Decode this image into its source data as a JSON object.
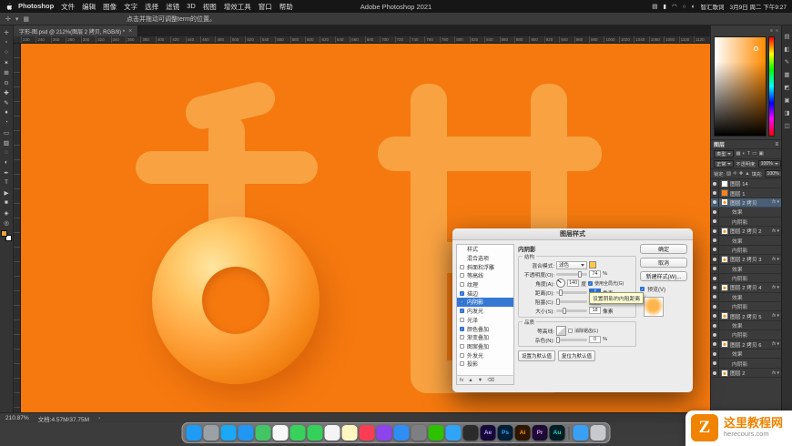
{
  "colors": {
    "canvas_bg": "#f5790f",
    "glyph": "#f9a242",
    "fg_swatch": "#f2a33c",
    "bg_swatch": "#ffffff",
    "swatch_yellow": "#ffc844",
    "accent": "#2f6fd0"
  },
  "icons": {
    "close": "×",
    "chevron": "›",
    "panel_menu": "≡",
    "collapse": "«"
  },
  "menubar": {
    "items": [
      "Photoshop",
      "文件",
      "编辑",
      "图像",
      "文字",
      "选择",
      "滤镜",
      "3D",
      "视图",
      "增效工具",
      "窗口",
      "帮助"
    ],
    "app_title": "Adobe Photoshop 2021",
    "status_icons": [
      {
        "name": "display-icon",
        "glyph": "▤"
      },
      {
        "name": "battery-icon",
        "glyph": "▮"
      },
      {
        "name": "wifi-icon",
        "glyph": "◠"
      },
      {
        "name": "search-icon",
        "glyph": "○"
      },
      {
        "name": "control-center-icon",
        "glyph": "◐"
      }
    ],
    "input_method": "智汇歌词",
    "datetime": "3月9日 周二 下午9:27"
  },
  "optionsbar": {
    "left_icons": [
      {
        "name": "tool-preset-icon",
        "glyph": "✛"
      },
      {
        "name": "auto-select-icon",
        "glyph": "▾"
      },
      {
        "name": "align-icon",
        "glyph": "▦"
      }
    ],
    "hint": "点击并拖动可调整term的位置。"
  },
  "tools": [
    {
      "name": "move-tool",
      "glyph": "✛"
    },
    {
      "name": "marquee-tool",
      "glyph": "▫"
    },
    {
      "name": "lasso-tool",
      "glyph": "○"
    },
    {
      "name": "quick-selection-tool",
      "glyph": "✶"
    },
    {
      "name": "crop-tool",
      "glyph": "⊞"
    },
    {
      "name": "eyedropper-tool",
      "glyph": "⊙"
    },
    {
      "name": "healing-brush-tool",
      "glyph": "✚"
    },
    {
      "name": "brush-tool",
      "glyph": "✎"
    },
    {
      "name": "clone-stamp-tool",
      "glyph": "♦"
    },
    {
      "name": "history-brush-tool",
      "glyph": "◔"
    },
    {
      "name": "eraser-tool",
      "glyph": "▭"
    },
    {
      "name": "gradient-tool",
      "glyph": "▨"
    },
    {
      "name": "blur-tool",
      "glyph": "◌"
    },
    {
      "name": "dodge-tool",
      "glyph": "◐"
    },
    {
      "name": "pen-tool",
      "glyph": "✒"
    },
    {
      "name": "type-tool",
      "glyph": "T"
    },
    {
      "name": "path-selection-tool",
      "glyph": "▶"
    },
    {
      "name": "shape-tool",
      "glyph": "■"
    },
    {
      "name": "hand-tool",
      "glyph": "◈"
    },
    {
      "name": "zoom-tool",
      "glyph": "◎"
    }
  ],
  "document": {
    "tab_title": "字形-图.psd @ 212%(图层 2 拷贝, RGB/8) *",
    "canvas_character": "甜",
    "ruler_ticks": [
      "220",
      "240",
      "260",
      "280",
      "300",
      "320",
      "340",
      "360",
      "380",
      "400",
      "420",
      "440",
      "460",
      "480",
      "500",
      "520",
      "540",
      "560",
      "580",
      "600",
      "620",
      "640",
      "660",
      "680",
      "700",
      "720",
      "740",
      "760",
      "780",
      "800",
      "820",
      "840",
      "860",
      "880",
      "900",
      "920",
      "940",
      "960",
      "980",
      "1000",
      "1020",
      "1040",
      "1060",
      "1080",
      "1100",
      "1120"
    ],
    "zoom_level": "210.87%",
    "doc_size": "文档:4.57M/37.75M"
  },
  "dialog": {
    "title": "图层样式",
    "left_items": [
      {
        "label": "样式",
        "checkbox": false
      },
      {
        "label": "混合选项",
        "checkbox": false
      },
      {
        "label": "斜面和浮雕",
        "checkbox": true,
        "checked": false
      },
      {
        "label": "等高线",
        "checkbox": true,
        "checked": false
      },
      {
        "label": "纹理",
        "checkbox": true,
        "checked": false
      },
      {
        "label": "描边",
        "checkbox": true,
        "checked": true
      },
      {
        "label": "内阴影",
        "checkbox": true,
        "checked": true,
        "selected": true
      },
      {
        "label": "内发光",
        "checkbox": true,
        "checked": true
      },
      {
        "label": "光泽",
        "checkbox": true,
        "checked": false
      },
      {
        "label": "颜色叠加",
        "checkbox": true,
        "checked": true
      },
      {
        "label": "渐变叠加",
        "checkbox": true,
        "checked": false
      },
      {
        "label": "图案叠加",
        "checkbox": true,
        "checked": false
      },
      {
        "label": "外发光",
        "checkbox": true,
        "checked": false
      },
      {
        "label": "投影",
        "checkbox": true,
        "checked": false
      }
    ],
    "list_foot_icons": [
      {
        "name": "add-effect-icon",
        "glyph": "fx"
      },
      {
        "name": "move-up-icon",
        "glyph": "▲"
      },
      {
        "name": "move-down-icon",
        "glyph": "▼"
      },
      {
        "name": "delete-effect-icon",
        "glyph": "⌫"
      }
    ],
    "panel": {
      "header": "内阴影",
      "structure_label": "结构",
      "blend_mode_label": "混合模式:",
      "blend_mode_value": "滤色",
      "opacity_label": "不透明度(O):",
      "opacity_value": "74",
      "opacity_unit": "%",
      "angle_label": "角度(A):",
      "angle_value": "140",
      "angle_unit": "度",
      "global_light_label": "使用全局光(G)",
      "distance_label": "距离(D):",
      "distance_value": "7",
      "distance_unit": "像素",
      "choke_label": "阻塞(C):",
      "choke_value": "0",
      "choke_unit": "%",
      "size_label": "大小(S):",
      "size_value": "18",
      "size_unit": "像素",
      "quality_label": "品质",
      "contour_label": "等高线:",
      "antialias_label": "消除锯齿(L)",
      "noise_label": "杂色(N):",
      "noise_value": "0",
      "noise_unit": "%",
      "set_default": "设置为默认值",
      "reset_default": "复位为默认值",
      "tooltip": "设置阴影的内阻距离"
    },
    "right": {
      "ok": "确定",
      "cancel": "取消",
      "new_style": "新建样式(W)...",
      "preview": "预览(V)"
    }
  },
  "layers_panel": {
    "tab": "图层",
    "filter_label": "类型",
    "filter_icons": [
      {
        "name": "filter-pixel-icon",
        "glyph": "▦"
      },
      {
        "name": "filter-adjustment-icon",
        "glyph": "◐"
      },
      {
        "name": "filter-type-icon",
        "glyph": "T"
      },
      {
        "name": "filter-shape-icon",
        "glyph": "▭"
      },
      {
        "name": "filter-smart-icon",
        "glyph": "▣"
      }
    ],
    "blend_mode": "正常",
    "opacity_label": "不透明度:",
    "opacity_value": "100%",
    "lock_label": "锁定:",
    "lock_icons": [
      {
        "name": "lock-transparent-icon",
        "glyph": "▨"
      },
      {
        "name": "lock-pixels-icon",
        "glyph": "✛"
      },
      {
        "name": "lock-position-icon",
        "glyph": "✚"
      },
      {
        "name": "lock-all-icon",
        "glyph": "▲"
      }
    ],
    "fill_label": "填充:",
    "fill_value": "100%",
    "rows": [
      {
        "kind": "layer",
        "name": "图层 14",
        "thumb": "white"
      },
      {
        "kind": "layer",
        "name": "图层 1",
        "thumb": "orange"
      },
      {
        "kind": "layer",
        "name": "图层 2 拷贝",
        "thumb": "glyph",
        "selected": true,
        "fx": true
      },
      {
        "kind": "fxgroup",
        "name": "效果"
      },
      {
        "kind": "fxitem",
        "name": "内阴影"
      },
      {
        "kind": "layer",
        "name": "图层 2 拷贝 2",
        "thumb": "glyph",
        "fx": true
      },
      {
        "kind": "fxgroup",
        "name": "效果"
      },
      {
        "kind": "fxitem",
        "name": "内阴影"
      },
      {
        "kind": "layer",
        "name": "图层 2 拷贝 3",
        "thumb": "glyph",
        "fx": true
      },
      {
        "kind": "fxgroup",
        "name": "效果"
      },
      {
        "kind": "fxitem",
        "name": "内阴影"
      },
      {
        "kind": "layer",
        "name": "图层 2 拷贝 4",
        "thumb": "glyph",
        "fx": true
      },
      {
        "kind": "fxgroup",
        "name": "效果"
      },
      {
        "kind": "fxitem",
        "name": "内阴影"
      },
      {
        "kind": "layer",
        "name": "图层 2 拷贝 5",
        "thumb": "glyph",
        "fx": true
      },
      {
        "kind": "fxgroup",
        "name": "效果"
      },
      {
        "kind": "fxitem",
        "name": "内阴影"
      },
      {
        "kind": "layer",
        "name": "图层 2 拷贝 6",
        "thumb": "glyph",
        "fx": true
      },
      {
        "kind": "fxgroup",
        "name": "效果"
      },
      {
        "kind": "fxitem",
        "name": "内阴影"
      },
      {
        "kind": "layer",
        "name": "图层 2",
        "thumb": "glyph",
        "fx": true
      }
    ],
    "bottom_icons": [
      {
        "name": "link-layers-icon",
        "glyph": "∞"
      },
      {
        "name": "layer-style-icon",
        "glyph": "fx"
      },
      {
        "name": "layer-mask-icon",
        "glyph": "◐"
      },
      {
        "name": "adjustment-layer-icon",
        "glyph": "◑"
      },
      {
        "name": "layer-group-icon",
        "glyph": "▣"
      },
      {
        "name": "new-layer-icon",
        "glyph": "+"
      },
      {
        "name": "delete-layer-icon",
        "glyph": "⌫"
      }
    ]
  },
  "right_strip": [
    {
      "name": "history-panel-icon",
      "glyph": "▤"
    },
    {
      "name": "properties-panel-icon",
      "glyph": "◧"
    },
    {
      "name": "brushes-panel-icon",
      "glyph": "✎"
    },
    {
      "name": "paths-panel-icon",
      "glyph": "▦"
    },
    {
      "name": "adjustments-panel-icon",
      "glyph": "◩"
    },
    {
      "name": "libraries-panel-icon",
      "glyph": "▣"
    },
    {
      "name": "info-panel-icon",
      "glyph": "◨"
    },
    {
      "name": "actions-panel-icon",
      "glyph": "◫"
    }
  ],
  "dock": {
    "items": [
      {
        "name": "finder",
        "color": "#1d9bf6",
        "label": ""
      },
      {
        "name": "launchpad",
        "color": "#9aa0a6",
        "label": ""
      },
      {
        "name": "safari",
        "color": "#1ba8f5",
        "label": ""
      },
      {
        "name": "mail",
        "color": "#2196f3",
        "label": ""
      },
      {
        "name": "maps",
        "color": "#43c465",
        "label": ""
      },
      {
        "name": "photos",
        "color": "#f7f7f7",
        "label": ""
      },
      {
        "name": "messages",
        "color": "#38d15c",
        "label": ""
      },
      {
        "name": "facetime",
        "color": "#35d05a",
        "label": ""
      },
      {
        "name": "calendar",
        "color": "#f4f4f4",
        "label": ""
      },
      {
        "name": "notes",
        "color": "#fdf6c2",
        "label": ""
      },
      {
        "name": "music",
        "color": "#fb3c55",
        "label": ""
      },
      {
        "name": "podcasts",
        "color": "#8e44ec",
        "label": ""
      },
      {
        "name": "app-store",
        "color": "#2f8ef4",
        "label": ""
      },
      {
        "name": "system-preferences",
        "color": "#7d7f83",
        "label": ""
      },
      {
        "name": "wechat",
        "color": "#2dc100",
        "label": ""
      },
      {
        "name": "qq",
        "color": "#30a5f7",
        "label": ""
      },
      {
        "name": "terminal",
        "color": "#2b2b2b",
        "label": ""
      },
      {
        "name": "after-effects",
        "color": "#17083a",
        "label": "Ae",
        "label_color": "#b3a6ff"
      },
      {
        "name": "photoshop",
        "color": "#001e36",
        "label": "Ps",
        "label_color": "#31a8ff"
      },
      {
        "name": "illustrator",
        "color": "#2e1500",
        "label": "Ai",
        "label_color": "#ff9a00"
      },
      {
        "name": "premiere",
        "color": "#1d0b33",
        "label": "Pr",
        "label_color": "#cf96fd"
      },
      {
        "name": "audition",
        "color": "#001c25",
        "label": "Au",
        "label_color": "#00e4bb"
      },
      {
        "name": "separator",
        "kind": "sep"
      },
      {
        "name": "downloads-folder",
        "color": "#3aa0f3",
        "label": ""
      },
      {
        "name": "trash",
        "color": "rgba(220,222,228,0.8)",
        "label": ""
      }
    ]
  },
  "watermark": {
    "logo": "Z",
    "site": "这里教程网",
    "url": "herecours.com"
  }
}
